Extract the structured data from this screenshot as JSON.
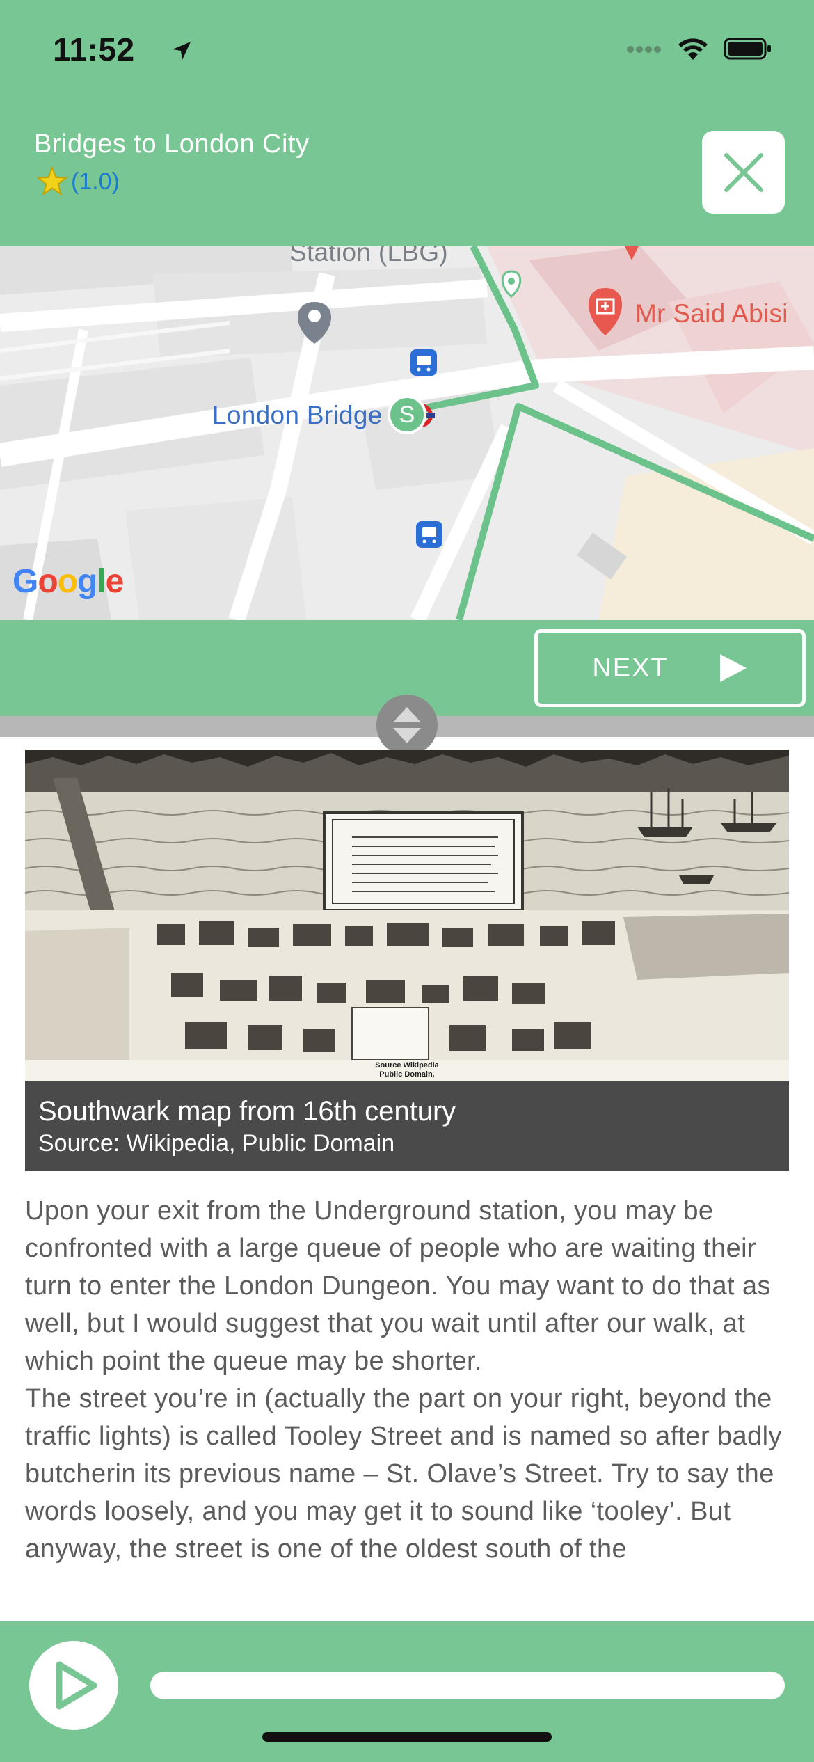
{
  "status_bar": {
    "time": "11:52"
  },
  "header": {
    "title": "Bridges to London City",
    "rating": "(1.0)",
    "close_icon": "close-icon",
    "colors": {
      "bar": "#77c693",
      "rating_text": "#1a7bd0",
      "star": "#f2d21b"
    }
  },
  "map": {
    "labels": {
      "station_partial": "Station (LBG)",
      "london_bridge": "London Bridge",
      "poi": "Mr Said Abisi",
      "attribution": "Google"
    },
    "start_marker": "S",
    "route_color": "#6cc28b"
  },
  "navigation": {
    "next_label": "NEXT"
  },
  "content": {
    "figure_source": "Source Wikipedia\nPublic Domain.",
    "caption_title": "Southwark map from 16th century",
    "caption_subtitle": "Source: Wikipedia, Public Domain",
    "paragraphs": [
      "Upon your exit from the Underground station, you may be confronted with a large queue of people who are waiting their turn to enter the London Dungeon. You may want to do that as well, but I would suggest that you wait until after our walk, at which point the queue may be shorter.",
      "The street you’re in (actually the part on your right, beyond the traffic lights) is called Tooley Street and is named so after badly butcherin its previous name – St. Olave’s Street. Try to say the words loosely, and you may get it to sound like ‘tooley’. But anyway, the street is one of the oldest south of the"
    ]
  },
  "player": {
    "play_icon": "play-icon",
    "progress": 0
  }
}
